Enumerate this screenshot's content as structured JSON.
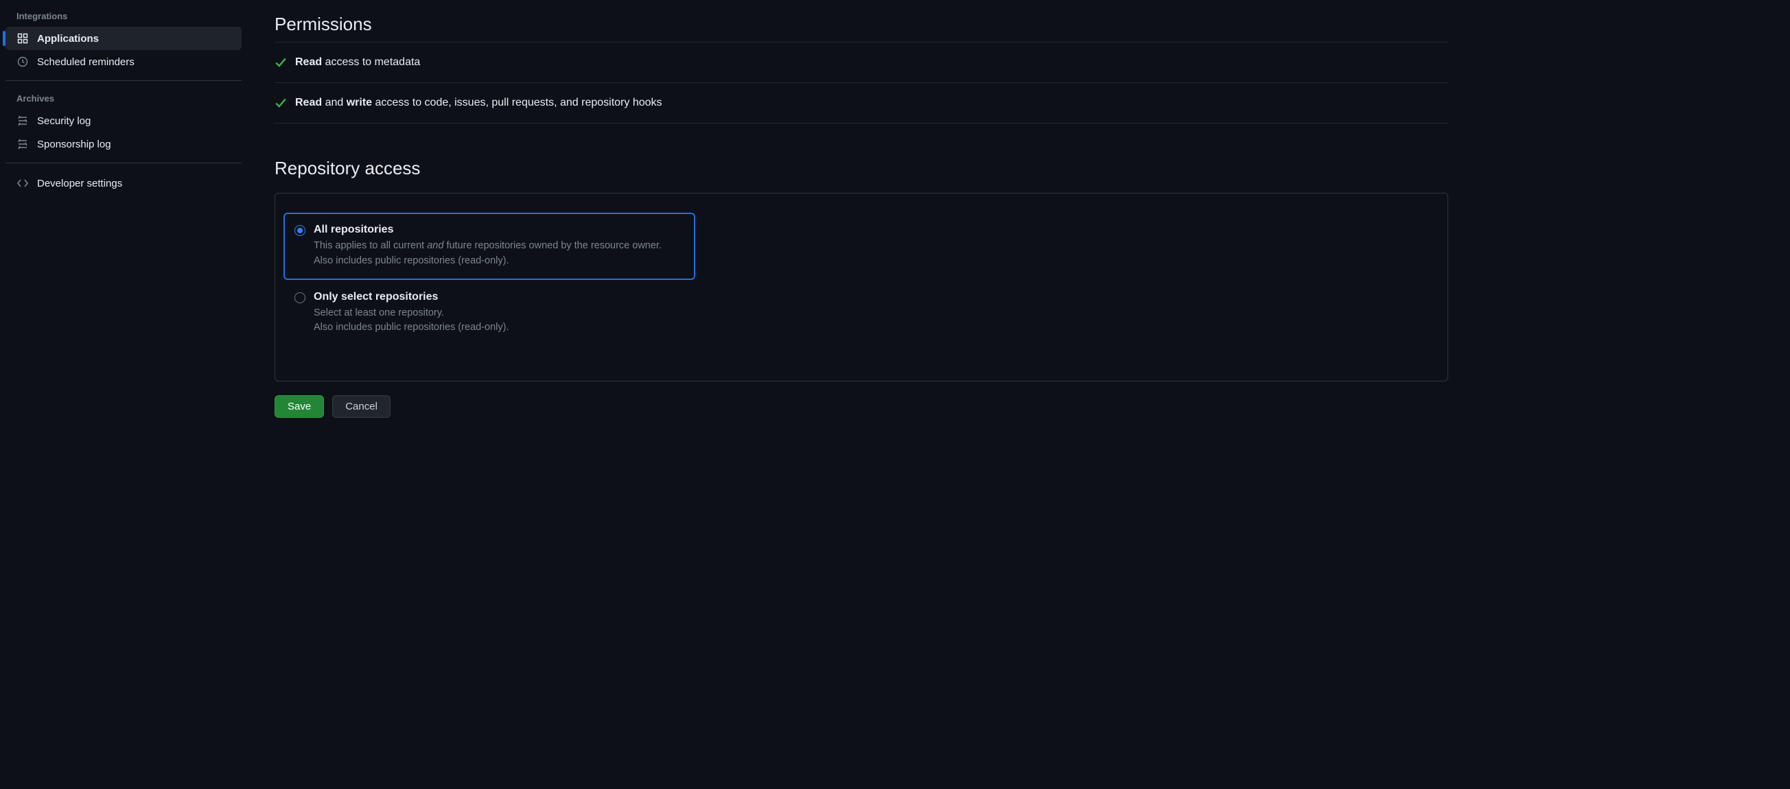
{
  "sidebar": {
    "integrations_heading": "Integrations",
    "applications": "Applications",
    "scheduled_reminders": "Scheduled reminders",
    "archives_heading": "Archives",
    "security_log": "Security log",
    "sponsorship_log": "Sponsorship log",
    "developer_settings": "Developer settings"
  },
  "permissions": {
    "title": "Permissions",
    "items": [
      {
        "strong": "Read",
        "rest": " access to metadata"
      },
      {
        "strong": "Read",
        "mid": " and ",
        "strong2": "write",
        "rest": " access to code, issues, pull requests, and repository hooks"
      }
    ]
  },
  "repo_access": {
    "title": "Repository access",
    "options": [
      {
        "label": "All repositories",
        "desc_pre": "This applies to all current ",
        "desc_em": "and",
        "desc_post": " future repositories owned by the resource owner.",
        "desc_line2": "Also includes public repositories (read-only).",
        "selected": true
      },
      {
        "label": "Only select repositories",
        "desc_line1": "Select at least one repository.",
        "desc_line2": "Also includes public repositories (read-only).",
        "selected": false
      }
    ]
  },
  "buttons": {
    "save": "Save",
    "cancel": "Cancel"
  }
}
